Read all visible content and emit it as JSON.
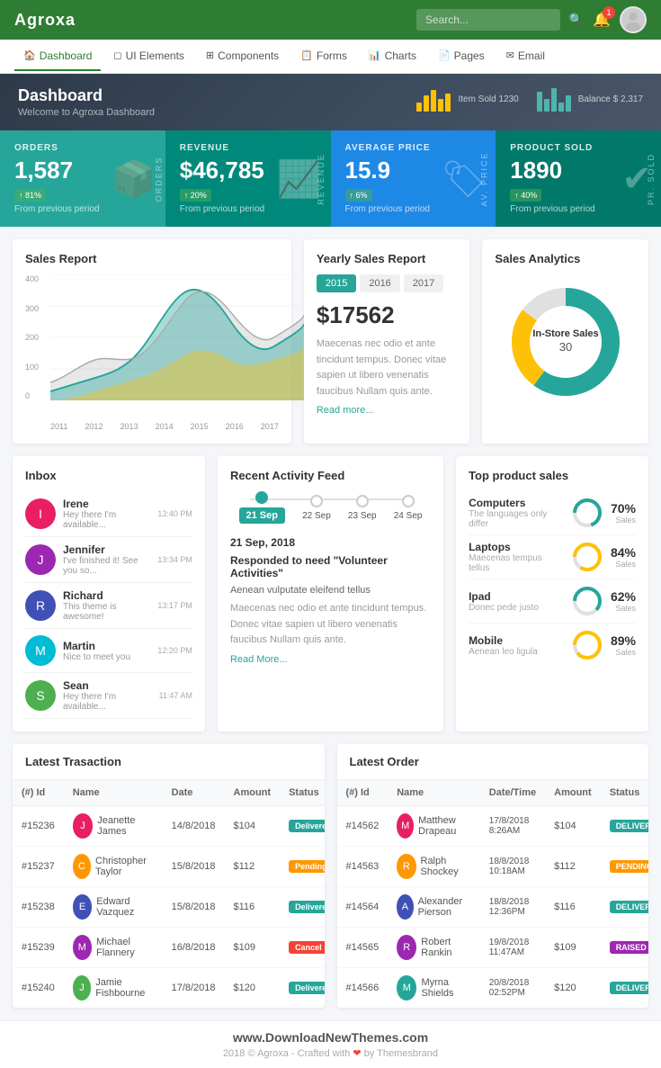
{
  "header": {
    "brand": "Agroxa",
    "search_placeholder": "Search...",
    "notif_count": "1",
    "stat1_label": "Item Sold 1230",
    "stat2_label": "Balance $ 2,317"
  },
  "nav": {
    "items": [
      {
        "label": "Dashboard",
        "icon": "🏠",
        "active": true
      },
      {
        "label": "UI Elements",
        "icon": "◻"
      },
      {
        "label": "Components",
        "icon": "⊞"
      },
      {
        "label": "Forms",
        "icon": "📋"
      },
      {
        "label": "Charts",
        "icon": "📊"
      },
      {
        "label": "Pages",
        "icon": "📄"
      },
      {
        "label": "Email",
        "icon": "✉"
      }
    ]
  },
  "dash_header": {
    "title": "Dashboard",
    "subtitle": "Welcome to Agroxa Dashboard"
  },
  "metrics": [
    {
      "label": "ORDERS",
      "value": "1,587",
      "badge": "81%",
      "badge_type": "up",
      "from": "From previous period",
      "icon": "📦",
      "side": "ORDERS"
    },
    {
      "label": "REVENUE",
      "value": "$46,785",
      "badge": "20%",
      "badge_type": "up",
      "from": "From previous period",
      "icon": "📈",
      "side": "REVENUE"
    },
    {
      "label": "AVERAGE PRICE",
      "value": "15.9",
      "badge": "6%",
      "badge_type": "up",
      "from": "From previous period",
      "icon": "🏷",
      "side": "AV. PRICE"
    },
    {
      "label": "PRODUCT SOLD",
      "value": "1890",
      "badge": "40%",
      "badge_type": "up",
      "from": "From previous period",
      "icon": "✔",
      "side": "PR. SOLD"
    }
  ],
  "sales_report": {
    "title": "Sales Report",
    "y_labels": [
      "400",
      "300",
      "200",
      "100",
      "0"
    ],
    "x_labels": [
      "2011",
      "2012",
      "2013",
      "2014",
      "2015",
      "2016",
      "2017"
    ]
  },
  "yearly_sales": {
    "title": "Yearly Sales Report",
    "tabs": [
      "2015",
      "2016",
      "2017"
    ],
    "active_tab": "2015",
    "value": "$17562",
    "text": "Maecenas nec odio et ante tincidunt tempus. Donec vitae sapien ut libero venenatis faucibus Nullam quis ante.",
    "read_more": "Read more..."
  },
  "sales_analytics": {
    "title": "Sales Analytics",
    "center_label": "In-Store Sales",
    "center_value": "30",
    "segments": [
      {
        "color": "#26a69a",
        "pct": 60
      },
      {
        "color": "#ffc107",
        "pct": 25
      },
      {
        "color": "#e0e0e0",
        "pct": 15
      }
    ]
  },
  "inbox": {
    "title": "Inbox",
    "items": [
      {
        "name": "Irene",
        "preview": "Hey there I'm available...",
        "time": "13:40 PM",
        "color": "#e91e63"
      },
      {
        "name": "Jennifer",
        "preview": "I've finished it! See you so...",
        "time": "13:34 PM",
        "color": "#9c27b0"
      },
      {
        "name": "Richard",
        "preview": "This theme is awesome!",
        "time": "13:17 PM",
        "color": "#3f51b5"
      },
      {
        "name": "Martin",
        "preview": "Nice to meet you",
        "time": "12:20 PM",
        "color": "#00bcd4"
      },
      {
        "name": "Sean",
        "preview": "Hey there I'm available...",
        "time": "11:47 AM",
        "color": "#4caf50"
      }
    ]
  },
  "activity": {
    "title": "Recent Activity Feed",
    "timeline": [
      {
        "date": "21 Sep",
        "active": true
      },
      {
        "date": "22 Sep",
        "active": false
      },
      {
        "date": "23 Sep",
        "active": false
      },
      {
        "date": "24 Sep",
        "active": false
      }
    ],
    "active_date": "21 Sep, 2018",
    "event_title": "Responded to need \"Volunteer Activities\"",
    "text1": "Aenean vulputate eleifend tellus",
    "text2": "Maecenas nec odio et ante tincidunt tempus. Donec vitae sapien ut libero venenatis faucibus Nullam quis ante.",
    "read_more": "Read More..."
  },
  "top_products": {
    "title": "Top product sales",
    "items": [
      {
        "name": "Computers",
        "sub": "The languages only differ",
        "pct": "70%",
        "label": "Sales",
        "fill": 70,
        "color": "#26a69a"
      },
      {
        "name": "Laptops",
        "sub": "Maecenas tempus tellus",
        "pct": "84%",
        "label": "Sales",
        "fill": 84,
        "color": "#ffc107"
      },
      {
        "name": "Ipad",
        "sub": "Donec pede justo",
        "pct": "62%",
        "label": "Sales",
        "fill": 62,
        "color": "#26a69a"
      },
      {
        "name": "Mobile",
        "sub": "Aenean leo ligula",
        "pct": "89%",
        "label": "Sales",
        "fill": 89,
        "color": "#ffc107"
      }
    ]
  },
  "latest_transaction": {
    "title": "Latest Trasaction",
    "headers": [
      "(#) Id",
      "Name",
      "Date",
      "Amount",
      "Status",
      ""
    ],
    "rows": [
      {
        "id": "#15236",
        "name": "Jeanette James",
        "date": "14/8/2018",
        "amount": "$104",
        "status": "Delivered",
        "status_type": "delivered"
      },
      {
        "id": "#15237",
        "name": "Christopher Taylor",
        "date": "15/8/2018",
        "amount": "$112",
        "status": "Pending",
        "status_type": "pending"
      },
      {
        "id": "#15238",
        "name": "Edward Vazquez",
        "date": "15/8/2018",
        "amount": "$116",
        "status": "Delivered",
        "status_type": "delivered"
      },
      {
        "id": "#15239",
        "name": "Michael Flannery",
        "date": "16/8/2018",
        "amount": "$109",
        "status": "Cancel",
        "status_type": "cancel"
      },
      {
        "id": "#15240",
        "name": "Jamie Fishbourne",
        "date": "17/8/2018",
        "amount": "$120",
        "status": "Delivered",
        "status_type": "delivered"
      }
    ]
  },
  "latest_order": {
    "title": "Latest Order",
    "headers": [
      "(#) Id",
      "Name",
      "Date/Time",
      "Amount",
      "Status",
      ""
    ],
    "rows": [
      {
        "id": "#14562",
        "name": "Matthew Drapeau",
        "datetime": "17/8/2018 8:26AM",
        "amount": "$104",
        "status": "DELIVERED",
        "status_type": "delivered"
      },
      {
        "id": "#14563",
        "name": "Ralph Shockey",
        "datetime": "18/8/2018 10:18AM",
        "amount": "$112",
        "status": "PENDING",
        "status_type": "pending"
      },
      {
        "id": "#14564",
        "name": "Alexander Pierson",
        "datetime": "18/8/2018 12:36PM",
        "amount": "$116",
        "status": "DELIVERED",
        "status_type": "delivered"
      },
      {
        "id": "#14565",
        "name": "Robert Rankin",
        "datetime": "19/8/2018 11:47AM",
        "amount": "$109",
        "status": "RAISED",
        "status_type": "raised"
      },
      {
        "id": "#14566",
        "name": "Myrna Shields",
        "datetime": "20/8/2018 02:52PM",
        "amount": "$120",
        "status": "DELIVERED",
        "status_type": "delivered"
      }
    ]
  },
  "footer": {
    "url": "www.DownloadNewThemes.com",
    "copy": "2018 © Agroxa - Crafted with",
    "by": "by Themesbrand"
  }
}
